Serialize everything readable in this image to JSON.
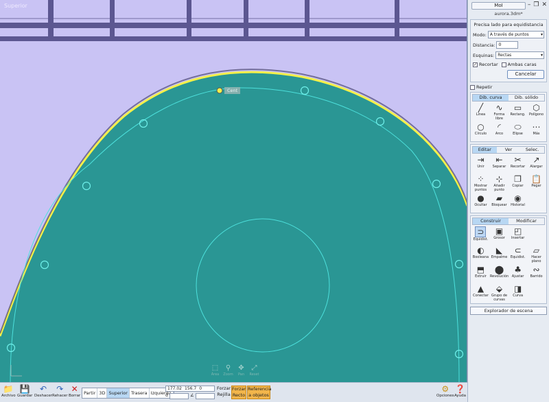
{
  "viewport": {
    "label": "Superior",
    "snap_label": "Cent",
    "nav": [
      {
        "label": "Área",
        "icon": "area-zoom-icon",
        "glyph": "⬚"
      },
      {
        "label": "Zoom",
        "icon": "zoom-icon",
        "glyph": "⚲"
      },
      {
        "label": "Pan",
        "icon": "pan-icon",
        "glyph": "✥"
      },
      {
        "label": "Reset",
        "icon": "reset-view-icon",
        "glyph": "⤢"
      }
    ]
  },
  "window": {
    "app_title": "MoI",
    "file_name": "aurora.3dm*",
    "minimize": "–",
    "restore": "❐",
    "close": "✕"
  },
  "command": {
    "title": "Precisa lado para equidistancia",
    "modo_label": "Modo:",
    "modo_value": "A través de puntos",
    "distancia_label": "Distancia:",
    "distancia_value": "0",
    "esquinas_label": "Esquinas:",
    "esquinas_value": "Rectas",
    "recortar_label": "Recortar",
    "recortar_checked": "✓",
    "ambas_label": "Ambas caras",
    "cancel_label": "Cancelar"
  },
  "repeat_label": "Repetir",
  "curve_group": {
    "tabs": [
      "Dib. curva",
      "Dib. sólido"
    ],
    "tools": [
      {
        "label": "Línea",
        "icon": "line-icon",
        "glyph": "╱"
      },
      {
        "label": "Forma libre",
        "icon": "freeform-icon",
        "glyph": "∿"
      },
      {
        "label": "Rectang.",
        "icon": "rectangle-icon",
        "glyph": "▭"
      },
      {
        "label": "Polígono",
        "icon": "polygon-icon",
        "glyph": "⬡"
      },
      {
        "label": "Círculo",
        "icon": "circle-icon",
        "glyph": "○"
      },
      {
        "label": "Arco",
        "icon": "arc-icon",
        "glyph": "◜"
      },
      {
        "label": "Elipse",
        "icon": "ellipse-icon",
        "glyph": "⬭"
      },
      {
        "label": "Más",
        "icon": "more-icon",
        "glyph": "⋯"
      }
    ]
  },
  "edit_group": {
    "tabs": [
      "Editar",
      "Ver",
      "Selec."
    ],
    "tools": [
      {
        "label": "Unir",
        "icon": "join-icon",
        "glyph": "⇥"
      },
      {
        "label": "Separar",
        "icon": "separate-icon",
        "glyph": "⇤"
      },
      {
        "label": "Recortar",
        "icon": "trim-icon",
        "glyph": "✂"
      },
      {
        "label": "Alargar",
        "icon": "extend-icon",
        "glyph": "↗"
      },
      {
        "label": "Mostrar puntos",
        "icon": "show-points-icon",
        "glyph": "⁘"
      },
      {
        "label": "Añadir punto",
        "icon": "add-point-icon",
        "glyph": "⊹"
      },
      {
        "label": "Copiar",
        "icon": "copy-icon",
        "glyph": "❐"
      },
      {
        "label": "Pegar",
        "icon": "paste-icon",
        "glyph": "📋"
      },
      {
        "label": "Ocultar",
        "icon": "hide-icon",
        "glyph": "●"
      },
      {
        "label": "Bloquear",
        "icon": "lock-icon",
        "glyph": "▰"
      },
      {
        "label": "Historial",
        "icon": "history-icon",
        "glyph": "◉"
      }
    ]
  },
  "build_group": {
    "tabs": [
      "Construir",
      "Modificar"
    ],
    "tools": [
      {
        "label": "Equidist.",
        "icon": "offset-icon",
        "glyph": "⊃",
        "selected": true
      },
      {
        "label": "Grosor",
        "icon": "shell-icon",
        "glyph": "▣"
      },
      {
        "label": "Insertar",
        "icon": "inset-icon",
        "glyph": "◰"
      },
      {
        "label": "",
        "icon": "",
        "glyph": ""
      },
      {
        "label": "Booleana",
        "icon": "boolean-icon",
        "glyph": "◐"
      },
      {
        "label": "Empalme",
        "icon": "fillet-icon",
        "glyph": "◣"
      },
      {
        "label": "Equidist.",
        "icon": "offset-solid-icon",
        "glyph": "⊂"
      },
      {
        "label": "Hacer plano",
        "icon": "make-planar-icon",
        "glyph": "▱"
      },
      {
        "label": "Extruir",
        "icon": "extrude-icon",
        "glyph": "⬒"
      },
      {
        "label": "Revolución",
        "icon": "revolve-icon",
        "glyph": "⬤"
      },
      {
        "label": "Ajustar",
        "icon": "sweep-icon",
        "glyph": "♣"
      },
      {
        "label": "Barrido",
        "icon": "loft-icon",
        "glyph": "∾"
      },
      {
        "label": "Conectar",
        "icon": "connect-icon",
        "glyph": "▲"
      },
      {
        "label": "Grupo de curvas",
        "icon": "network-icon",
        "glyph": "⬙"
      },
      {
        "label": "Curva",
        "icon": "curve-icon",
        "glyph": "◨"
      }
    ]
  },
  "explorer_label": "Explorador de escena",
  "bottom": {
    "file_btns": [
      {
        "label": "Archivo",
        "icon": "folder-icon",
        "glyph": "📁"
      },
      {
        "label": "Guardar",
        "icon": "save-icon",
        "glyph": "💾"
      },
      {
        "label": "Deshacer",
        "icon": "undo-icon",
        "glyph": "↶"
      },
      {
        "label": "Rehacer",
        "icon": "redo-icon",
        "glyph": "↷"
      },
      {
        "label": "Borrar",
        "icon": "delete-icon",
        "glyph": "✕"
      }
    ],
    "views": [
      "Partir",
      "3D",
      "Superior",
      "Trasera",
      "Izquierda"
    ],
    "active_view": "Superior",
    "coord_x": "177.02",
    "coord_y": "156.7",
    "coord_z": "0",
    "coord_d": "d",
    "coord_a": "∠",
    "snap_left": "Forzar Rejilla",
    "snap_mid": "Forzar Recto",
    "snap_right": "Referencia a objetos",
    "options_label": "Opciones",
    "help_label": "Ayuda"
  },
  "colors": {
    "viewport_bg": "#c9c3f4",
    "shape_fill": "#2a9694",
    "offset_curve": "#4de0dc",
    "edge_yellow": "#f4f04a",
    "accent": "#b8d7f3",
    "snap_on": "#f2b54b"
  }
}
